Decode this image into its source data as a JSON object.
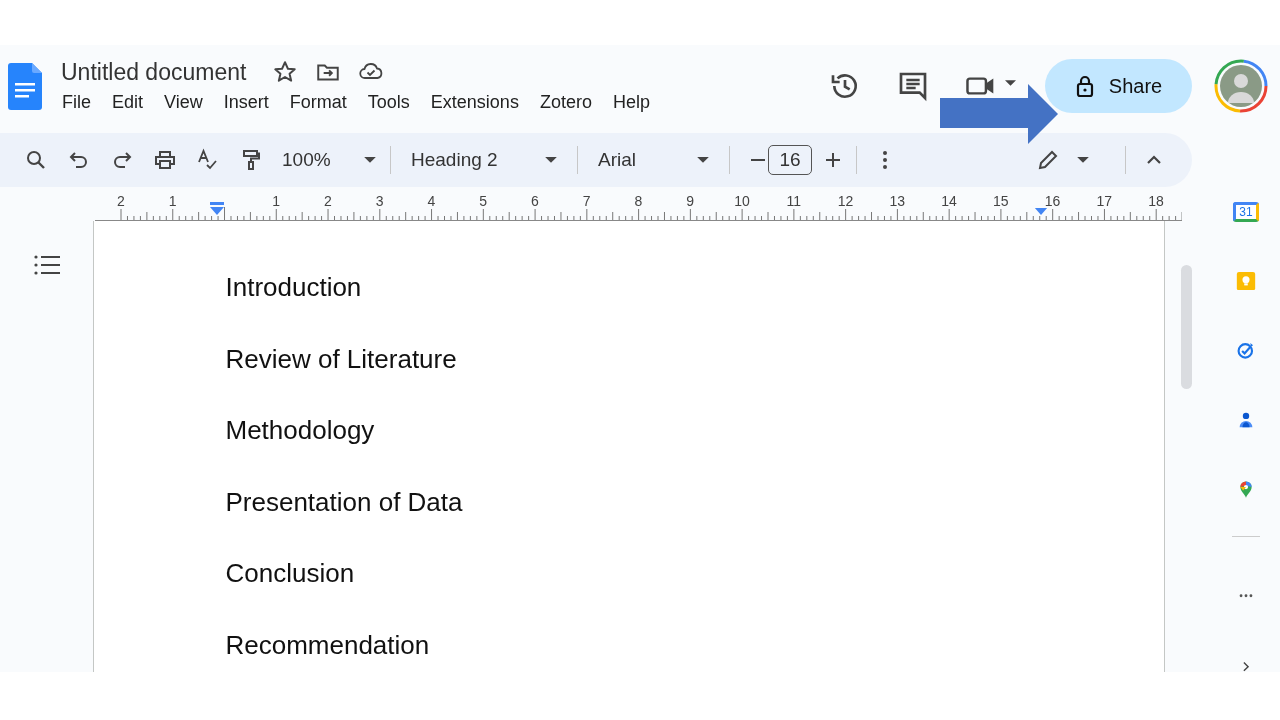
{
  "document": {
    "title": "Untitled document"
  },
  "menu": [
    "File",
    "Edit",
    "View",
    "Insert",
    "Format",
    "Tools",
    "Extensions",
    "Zotero",
    "Help"
  ],
  "share_button": {
    "label": "Share"
  },
  "toolbar": {
    "zoom": "100%",
    "style": "Heading 2",
    "font": "Arial",
    "font_size": "16"
  },
  "ruler": {
    "labels": [
      "2",
      "1",
      "1",
      "2",
      "3",
      "4",
      "5",
      "6",
      "7",
      "8",
      "9",
      "10",
      "11",
      "12",
      "13",
      "14",
      "15",
      "16",
      "17",
      "18"
    ]
  },
  "headings": [
    "Introduction",
    "Review of Literature",
    "Methodology",
    "Presentation of Data",
    "Conclusion",
    "Recommendation"
  ],
  "side_panel": {
    "calendar_date": "31"
  }
}
